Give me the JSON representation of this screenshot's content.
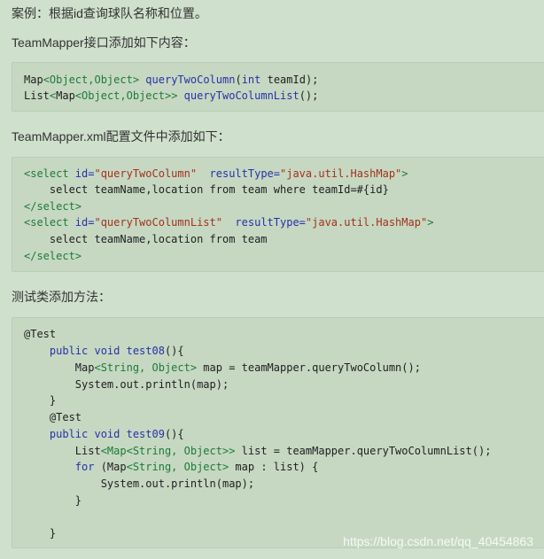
{
  "heading": "案例：根据id查询球队名称和位置。",
  "section1_label": "TeamMapper接口添加如下内容：",
  "code1": {
    "l1_type": "Map<Object,Object>",
    "l1_method": "queryTwoColumn",
    "l1_params": "(int teamId);",
    "l2_type": "List<Map<Object,Object>>",
    "l2_method": "queryTwoColumnList",
    "l2_params": "();"
  },
  "section2_label": "TeamMapper.xml配置文件中添加如下：",
  "code2": {
    "l1_open": "<select",
    "l1_attr1": " id=",
    "l1_val1": "\"queryTwoColumn\"",
    "l1_attr2": "  resultType=",
    "l1_val2": "\"java.util.HashMap\"",
    "l1_close": ">",
    "l2": "    select teamName,location from team where teamId=#{id}",
    "l3": "</select>",
    "l4_open": "<select",
    "l4_attr1": " id=",
    "l4_val1": "\"queryTwoColumnList\"",
    "l4_attr2": "  resultType=",
    "l4_val2": "\"java.util.HashMap\"",
    "l4_close": ">",
    "l5": "    select teamName,location from team",
    "l6": "</select>"
  },
  "section3_label": "测试类添加方法：",
  "code3": {
    "l1": "@Test",
    "l2_kw": "    public void ",
    "l2_name": "test08",
    "l2_rest": "(){",
    "l3_a": "        Map",
    "l3_type": "<String, Object>",
    "l3_b": " map = teamMapper.queryTwoColumn();",
    "l4": "        System.out.println(map);",
    "l5": "    }",
    "l6": "    @Test",
    "l7_kw": "    public void ",
    "l7_name": "test09",
    "l7_rest": "(){",
    "l8_a": "        List",
    "l8_type1": "<Map",
    "l8_type2": "<String, Object>>",
    "l8_b": " list = teamMapper.queryTwoColumnList();",
    "l9_kw": "        for",
    "l9_a": " (Map",
    "l9_type": "<String, Object>",
    "l9_b": " map : list) {",
    "l10": "            System.out.println(map);",
    "l11": "        }",
    "l12": "",
    "l13": "    }"
  },
  "watermark": "https://blog.csdn.net/qq_40454863"
}
